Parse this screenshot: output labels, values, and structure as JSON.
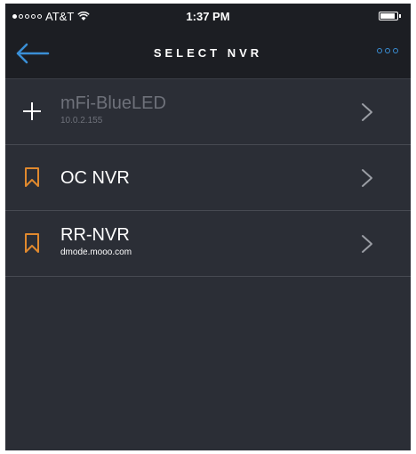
{
  "status_bar": {
    "carrier": "AT&T",
    "time": "1:37 PM"
  },
  "navbar": {
    "title": "SELECT NVR"
  },
  "colors": {
    "accent": "#3a8fd6",
    "bookmark": "#e0892e",
    "background": "#2b2e36",
    "bar": "#1c1e23"
  },
  "nvr_list": [
    {
      "name": "mFi-BlueLED",
      "subtitle": "10.0.2.155",
      "icon": "plus-icon",
      "disabled": true
    },
    {
      "name": "OC NVR",
      "subtitle": "",
      "icon": "bookmark-icon",
      "disabled": false
    },
    {
      "name": "RR-NVR",
      "subtitle": "dmode.mooo.com",
      "icon": "bookmark-icon",
      "disabled": false
    }
  ]
}
